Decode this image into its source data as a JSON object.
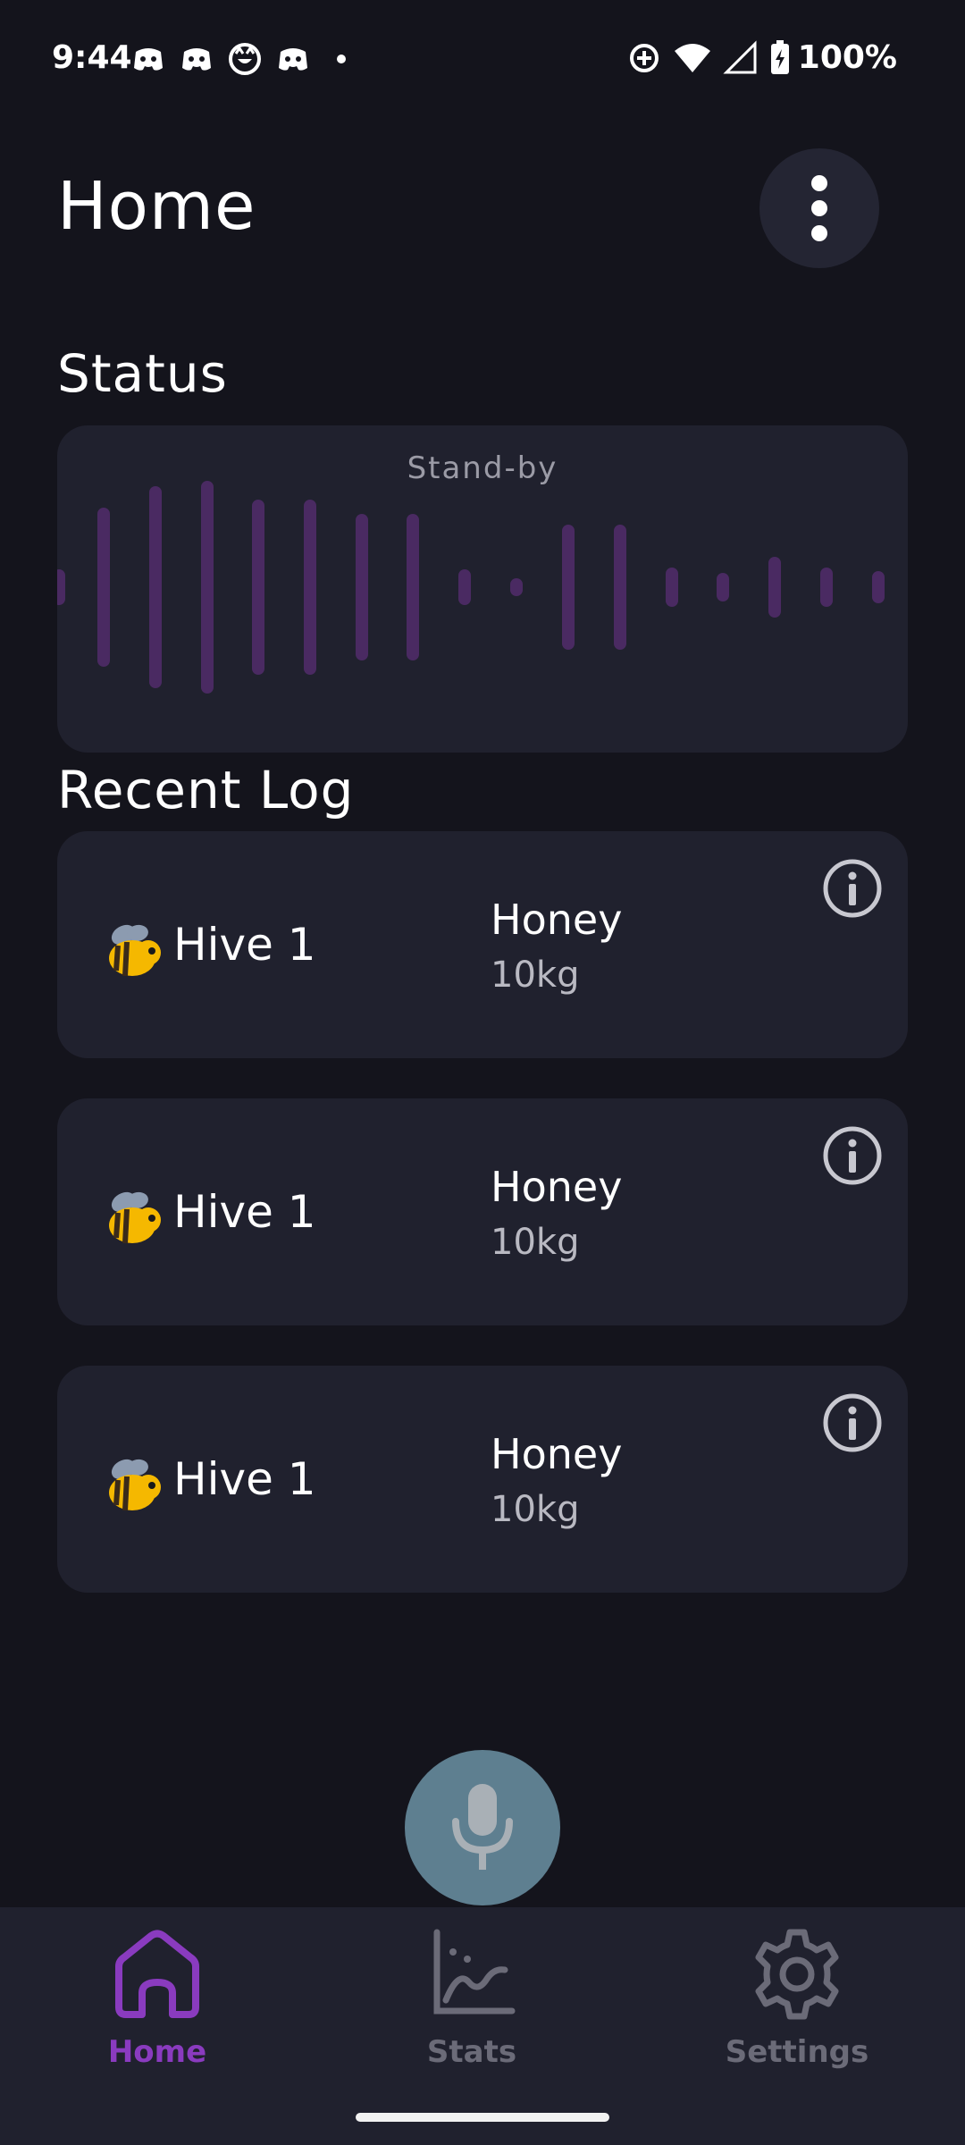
{
  "status_bar": {
    "time": "9:44",
    "battery": "100%",
    "notification_icons": [
      "discord-icon",
      "discord-icon",
      "cat-icon",
      "discord-icon",
      "dot-icon"
    ],
    "system_icons": [
      "data-saver-icon",
      "wifi-icon",
      "cell-signal-icon",
      "battery-charging-icon"
    ]
  },
  "header": {
    "title": "Home",
    "menu_icon": "more-vert-icon"
  },
  "status_section": {
    "title": "Status",
    "state_label": "Stand-by",
    "waveform_color": "#4a2a62"
  },
  "recent_log": {
    "title": "Recent Log",
    "items": [
      {
        "icon": "bee-icon",
        "hive": "Hive 1",
        "type": "Honey",
        "amount": "10kg"
      },
      {
        "icon": "bee-icon",
        "hive": "Hive 1",
        "type": "Honey",
        "amount": "10kg"
      },
      {
        "icon": "bee-icon",
        "hive": "Hive 1",
        "type": "Honey",
        "amount": "10kg"
      }
    ]
  },
  "mic": {
    "icon": "microphone-icon",
    "color": "#5e7f90"
  },
  "bottom_nav": {
    "items": [
      {
        "label": "Home",
        "icon": "home-icon",
        "active": true
      },
      {
        "label": "Stats",
        "icon": "chart-icon",
        "active": false
      },
      {
        "label": "Settings",
        "icon": "gear-icon",
        "active": false
      }
    ],
    "active_color": "#8a3bbf",
    "inactive_color": "#6b6b78"
  }
}
